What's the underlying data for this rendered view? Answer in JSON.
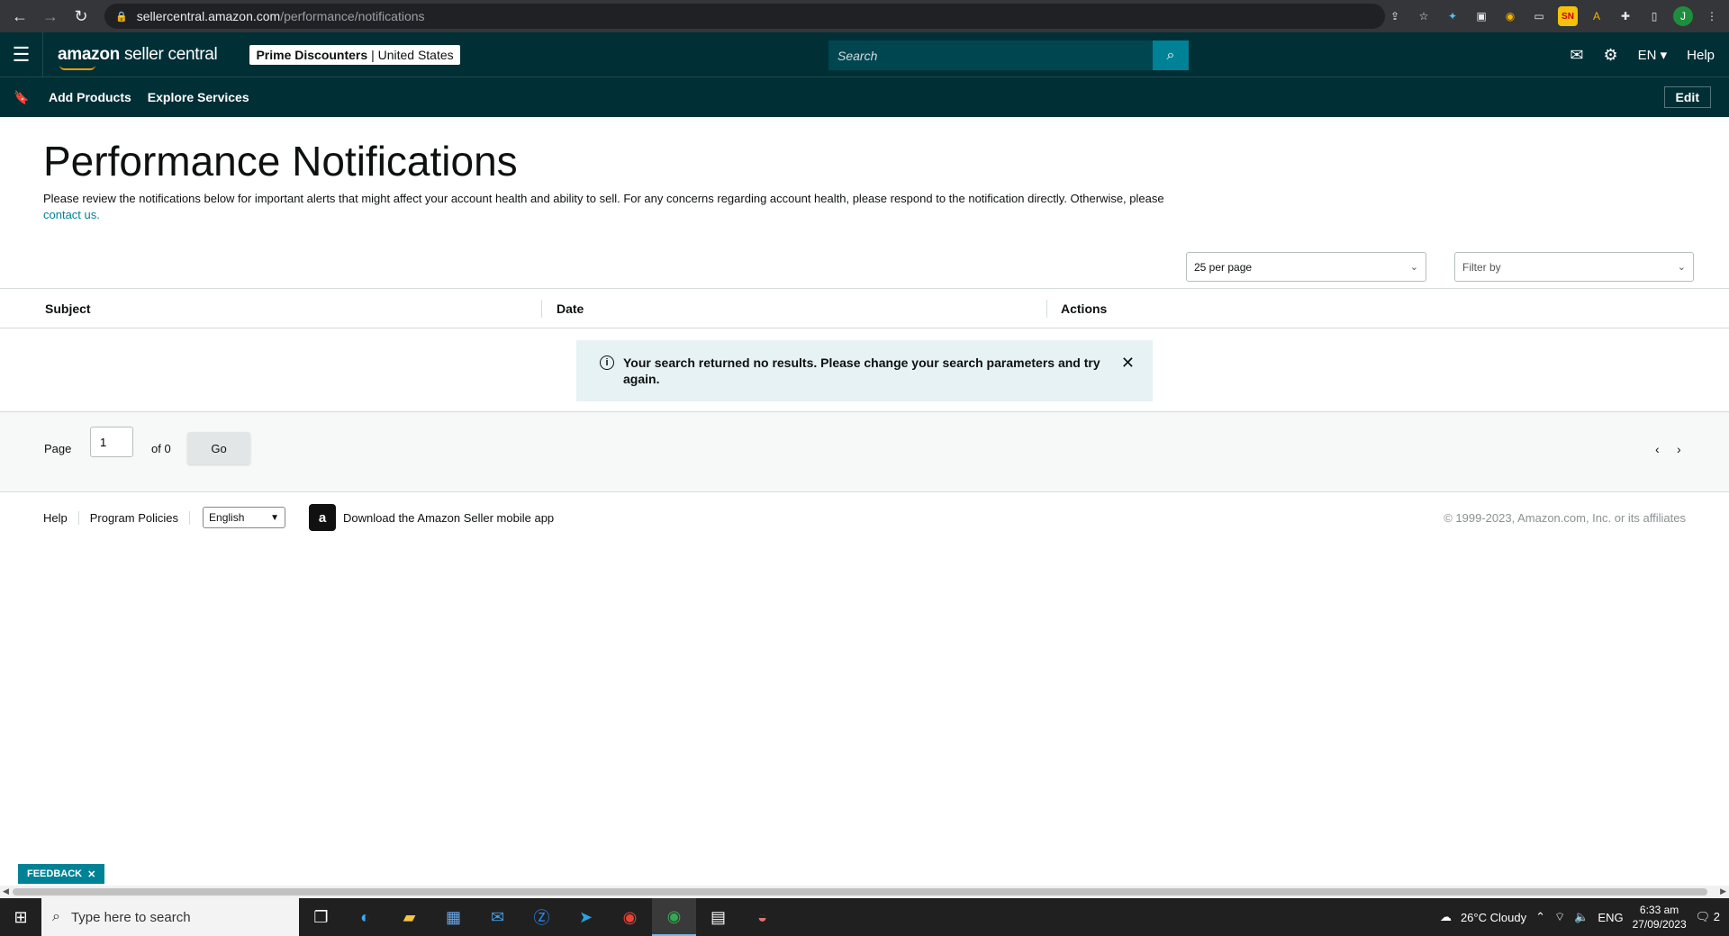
{
  "browser": {
    "url_host": "sellercentral.amazon.com",
    "url_path": "/performance/notifications",
    "profile_initial": "J"
  },
  "header": {
    "logo_brand": "amazon",
    "logo_product": "seller central",
    "account_name": "Prime Discounters",
    "account_region": "| United States",
    "search_placeholder": "Search",
    "language": "EN",
    "help": "Help"
  },
  "subnav": {
    "links": [
      "Add Products",
      "Explore Services"
    ],
    "edit": "Edit"
  },
  "main": {
    "title": "Performance Notifications",
    "intro_text": "Please review the notifications below for important alerts that might affect your account health and ability to sell. For any concerns regarding account health, please respond to the notification directly. Otherwise, please",
    "contact_link": "contact us.",
    "per_page": "25 per page",
    "filter_placeholder": "Filter by",
    "columns": [
      "Subject",
      "Date",
      "Actions"
    ],
    "alert": "Your search returned no results. Please change your search parameters and try again."
  },
  "pager": {
    "page_label": "Page",
    "page_value": "1",
    "of_label": "of 0",
    "go": "Go"
  },
  "footer": {
    "help": "Help",
    "program_policies": "Program Policies",
    "language": "English",
    "app_text": "Download the Amazon Seller mobile app",
    "copyright": "© 1999-2023, Amazon.com, Inc. or its affiliates"
  },
  "feedback": "FEEDBACK",
  "taskbar": {
    "search_placeholder": "Type here to search",
    "weather": "26°C  Cloudy",
    "lang": "ENG",
    "time": "6:33 am",
    "date": "27/09/2023",
    "notif_count": "2"
  },
  "colors": {
    "header_bg": "#002f36",
    "accent": "#008296",
    "alert_bg": "#e6f2f3"
  }
}
